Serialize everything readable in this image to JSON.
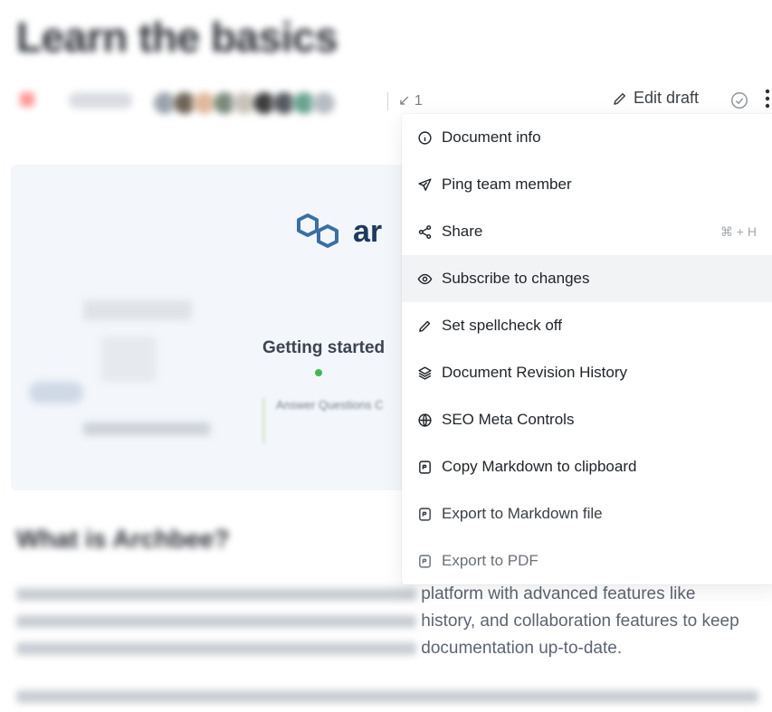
{
  "page": {
    "title": "Learn the basics",
    "version_count": "1",
    "edit_draft_label": "Edit draft"
  },
  "hero": {
    "logo_text": "ar",
    "getting_started": "Getting started",
    "answer_questions": "Answer Questions C"
  },
  "content": {
    "section_heading": "What is Archbee?",
    "para1_line1": "platform with advanced features like",
    "para1_line2": "history, and collaboration features to keep",
    "para1_line3": "documentation up-to-date."
  },
  "menu": {
    "items": [
      {
        "label": "Document info",
        "icon": "info-icon"
      },
      {
        "label": "Ping team member",
        "icon": "send-icon"
      },
      {
        "label": "Share",
        "icon": "share-icon",
        "shortcut": "⌘ + H"
      },
      {
        "label": "Subscribe to changes",
        "icon": "eye-icon"
      },
      {
        "label": "Set spellcheck off",
        "icon": "pencil-icon"
      },
      {
        "label": "Document Revision History",
        "icon": "layers-icon"
      },
      {
        "label": "SEO Meta Controls",
        "icon": "globe-icon"
      },
      {
        "label": "Copy Markdown to clipboard",
        "icon": "markdown-icon"
      },
      {
        "label": "Export to Markdown file",
        "icon": "markdown-icon"
      },
      {
        "label": "Export to PDF",
        "icon": "markdown-icon"
      }
    ]
  },
  "colors": {
    "accent": "#1e3a5f",
    "menu_hover": "#f2f3f5"
  }
}
